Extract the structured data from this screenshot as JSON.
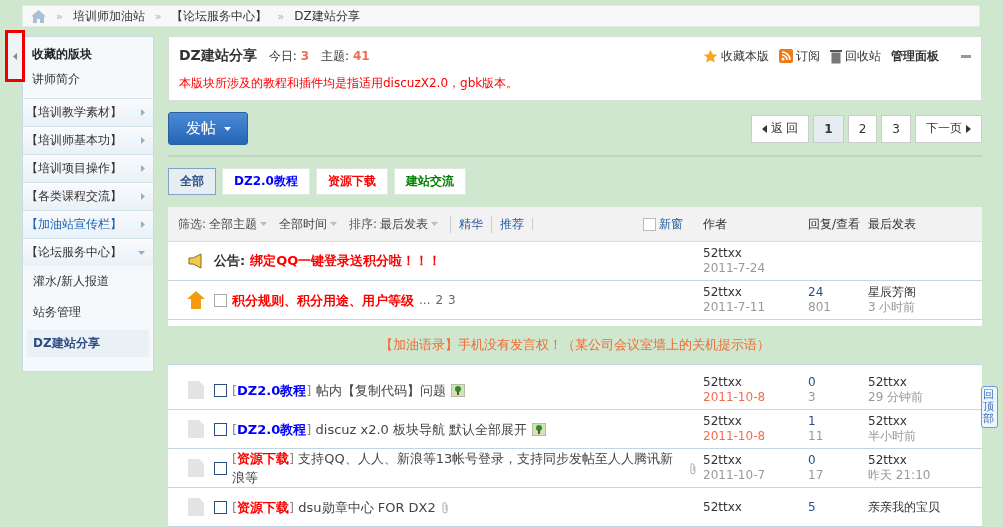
{
  "breadcrumb_separator": "»",
  "breadcrumb": [
    "培训师加油站",
    "【论坛服务中心】",
    "DZ建站分享"
  ],
  "sidebar": {
    "title": "收藏的版块",
    "favorites": [
      "讲师简介"
    ],
    "groups": [
      {
        "label": "【培训教学素材】",
        "expanded": false,
        "hovered": false
      },
      {
        "label": "【培训师基本功】",
        "expanded": false,
        "hovered": false
      },
      {
        "label": "【培训项目操作】",
        "expanded": false,
        "hovered": false
      },
      {
        "label": "【各类课程交流】",
        "expanded": false,
        "hovered": false
      },
      {
        "label": "【加油站宣传栏】",
        "expanded": false,
        "hovered": true
      },
      {
        "label": "【论坛服务中心】",
        "expanded": true,
        "hovered": false,
        "children": [
          {
            "label": "灌水/新人报道",
            "selected": false
          },
          {
            "label": "站务管理",
            "selected": false
          },
          {
            "label": "DZ建站分享",
            "selected": true
          }
        ]
      }
    ]
  },
  "forum": {
    "name": "DZ建站分享",
    "stats": [
      {
        "label": "今日:",
        "value": "3"
      },
      {
        "label": "主题:",
        "value": "41"
      }
    ],
    "notice": "本版块所涉及的教程和插件均是指适用discuzX2.0，gbk版本。",
    "actions": [
      {
        "kind": "star",
        "label": "收藏本版"
      },
      {
        "kind": "rss",
        "label": "订阅"
      },
      {
        "kind": "trash",
        "label": "回收站"
      },
      {
        "kind": "panel",
        "label": "管理面板"
      }
    ]
  },
  "post_button": "发帖",
  "pagination": {
    "prev": "返 回",
    "pages": [
      {
        "label": "1",
        "selected": true
      },
      {
        "label": "2",
        "selected": false
      },
      {
        "label": "3",
        "selected": false
      }
    ],
    "next": "下一页"
  },
  "type_tabs": [
    {
      "label": "全部",
      "selected": true,
      "color": "#2b4d83"
    },
    {
      "label": "DZ2.0教程",
      "selected": false,
      "color": "#0000ff"
    },
    {
      "label": "资源下载",
      "selected": false,
      "color": "#ff0000"
    },
    {
      "label": "建站交流",
      "selected": false,
      "color": "#008000"
    }
  ],
  "filter_bar": {
    "filter_label": "筛选:",
    "filters": [
      "全部主题",
      "全部时间"
    ],
    "sort_label": "排序:",
    "sort": "最后发表",
    "links": [
      "精华",
      "推荐"
    ],
    "new_window": {
      "label": "新窗",
      "checked": false
    },
    "columns": [
      "作者",
      "回复/查看",
      "最后发表"
    ]
  },
  "threads": [
    {
      "kind": "announcement",
      "prefix": "公告:",
      "title": "绑定QQ一键登录送积分啦！！！",
      "author": "52ttxx",
      "date": "2011-7-24"
    },
    {
      "kind": "sticky",
      "checked": false,
      "title": "积分规则、积分用途、用户等级",
      "ellipsis": "...",
      "pages": [
        "2",
        "3"
      ],
      "author": "52ttxx",
      "date": "2011-7-11",
      "replies": "24",
      "views": "801",
      "last_user": "星辰芳阁",
      "last_time": "3 小时前"
    },
    {
      "kind": "banner",
      "tag": "【加油语录】",
      "text": "手机没有发言权！（某公司会议室墙上的关机提示语）"
    },
    {
      "kind": "normal",
      "checked": false,
      "type_brackets": [
        "[",
        "]"
      ],
      "type": "DZ2.0教程",
      "color": "#0000ff",
      "title": "帖内【复制代码】问题",
      "attachment": {
        "kind": "image"
      },
      "author": "52ttxx",
      "date": "2011-10-8",
      "recent": true,
      "replies": "0",
      "views": "3",
      "last_user": "52ttxx",
      "last_time": "29 分钟前"
    },
    {
      "kind": "normal",
      "checked": false,
      "type_brackets": [
        "[",
        "]"
      ],
      "type": "DZ2.0教程",
      "color": "#0000ff",
      "title": "discuz x2.0 板块导航 默认全部展开",
      "attachment": {
        "kind": "image"
      },
      "author": "52ttxx",
      "date": "2011-10-8",
      "recent": true,
      "replies": "1",
      "views": "11",
      "last_user": "52ttxx",
      "last_time": "半小时前"
    },
    {
      "kind": "normal",
      "checked": false,
      "type_brackets": [
        "[",
        "]"
      ],
      "type": "资源下载",
      "color": "#ff0000",
      "title": "支持QQ、人人、新浪等13帐号登录，支持同步发帖至人人腾讯新浪等",
      "attachment": {
        "kind": "clip"
      },
      "author": "52ttxx",
      "date": "2011-10-7",
      "recent": false,
      "replies": "0",
      "views": "17",
      "last_user": "52ttxx",
      "last_time": "昨天 21:10"
    },
    {
      "kind": "normal",
      "checked": false,
      "type_brackets": [
        "[",
        "]"
      ],
      "type": "资源下载",
      "color": "#ff0000",
      "title": "dsu勋章中心 FOR DX2",
      "attachment": {
        "kind": "clip"
      },
      "author": "52ttxx",
      "replies": "5",
      "last_user": "亲亲我的宝贝"
    }
  ],
  "back_to_top": "回顶部"
}
